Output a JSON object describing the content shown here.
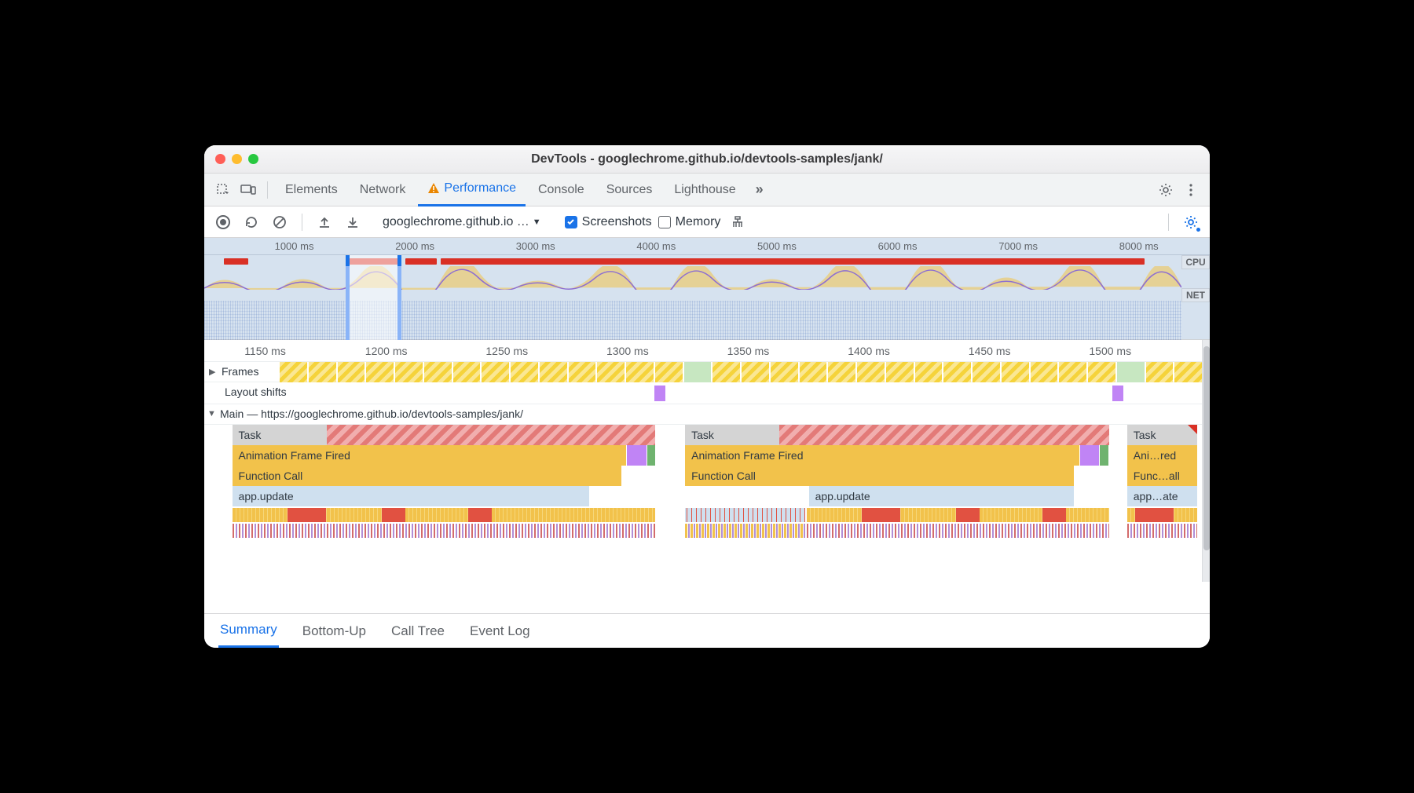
{
  "window": {
    "title": "DevTools - googlechrome.github.io/devtools-samples/jank/"
  },
  "top_tabs": {
    "items": [
      "Elements",
      "Network",
      "Performance",
      "Console",
      "Sources",
      "Lighthouse"
    ],
    "active": "Performance",
    "has_warning_on": "Performance"
  },
  "toolbar": {
    "url_select": "googlechrome.github.io …",
    "screenshots_label": "Screenshots",
    "screenshots_checked": true,
    "memory_label": "Memory",
    "memory_checked": false
  },
  "overview": {
    "ticks": [
      "1000 ms",
      "2000 ms",
      "3000 ms",
      "4000 ms",
      "5000 ms",
      "6000 ms",
      "7000 ms",
      "8000 ms"
    ],
    "side_badges": [
      "CPU",
      "NET"
    ],
    "selection": {
      "start_pct": 14.5,
      "end_pct": 20.2
    },
    "red_bars": [
      {
        "left_pct": 2,
        "width_pct": 2.5
      },
      {
        "left_pct": 14.8,
        "width_pct": 5.3
      },
      {
        "left_pct": 20.6,
        "width_pct": 3.2
      },
      {
        "left_pct": 24.2,
        "width_pct": 72
      }
    ]
  },
  "detail": {
    "ticks": [
      "1150 ms",
      "1200 ms",
      "1250 ms",
      "1300 ms",
      "1350 ms",
      "1400 ms",
      "1450 ms",
      "1500 ms"
    ],
    "frames_label": "Frames",
    "layout_shifts_label": "Layout shifts",
    "main_label": "Main — https://googlechrome.github.io/devtools-samples/jank/",
    "layout_shift_positions_pct": [
      44.8,
      90.3
    ],
    "tasks": [
      {
        "left_pct": 2.8,
        "width_pct": 42.4,
        "label": "Task",
        "long": true
      },
      {
        "left_pct": 48.2,
        "width_pct": 42.5,
        "label": "Task",
        "long": true
      },
      {
        "left_pct": 92.5,
        "width_pct": 7.0,
        "label": "Task",
        "corner": true
      }
    ],
    "stack_l2": [
      {
        "left_pct": 2.8,
        "width_pct": 39.5,
        "label": "Animation Frame Fired",
        "cls": "yellow"
      },
      {
        "left_pct": 42.4,
        "width_pct": 1.9,
        "cls": "purple"
      },
      {
        "left_pct": 44.4,
        "width_pct": 0.8,
        "cls": "green"
      },
      {
        "left_pct": 48.2,
        "width_pct": 39.5,
        "label": "Animation Frame Fired",
        "cls": "yellow"
      },
      {
        "left_pct": 87.8,
        "width_pct": 1.9,
        "cls": "purple"
      },
      {
        "left_pct": 89.8,
        "width_pct": 0.8,
        "cls": "green"
      },
      {
        "left_pct": 92.5,
        "width_pct": 7.0,
        "label": "Ani…red",
        "cls": "yellow"
      }
    ],
    "stack_l3": [
      {
        "left_pct": 2.8,
        "width_pct": 39.0,
        "label": "Function Call",
        "cls": "yellow"
      },
      {
        "left_pct": 48.2,
        "width_pct": 39.0,
        "label": "Function Call",
        "cls": "yellow"
      },
      {
        "left_pct": 92.5,
        "width_pct": 7.0,
        "label": "Func…all",
        "cls": "yellow"
      }
    ],
    "stack_l4": [
      {
        "left_pct": 2.8,
        "width_pct": 35.8,
        "label": "app.update",
        "cls": "blue"
      },
      {
        "left_pct": 60.6,
        "width_pct": 26.6,
        "label": "app.update",
        "cls": "blue"
      },
      {
        "left_pct": 92.5,
        "width_pct": 7.0,
        "label": "app…ate",
        "cls": "blue"
      }
    ]
  },
  "bottom_tabs": {
    "items": [
      "Summary",
      "Bottom-Up",
      "Call Tree",
      "Event Log"
    ],
    "active": "Summary"
  }
}
